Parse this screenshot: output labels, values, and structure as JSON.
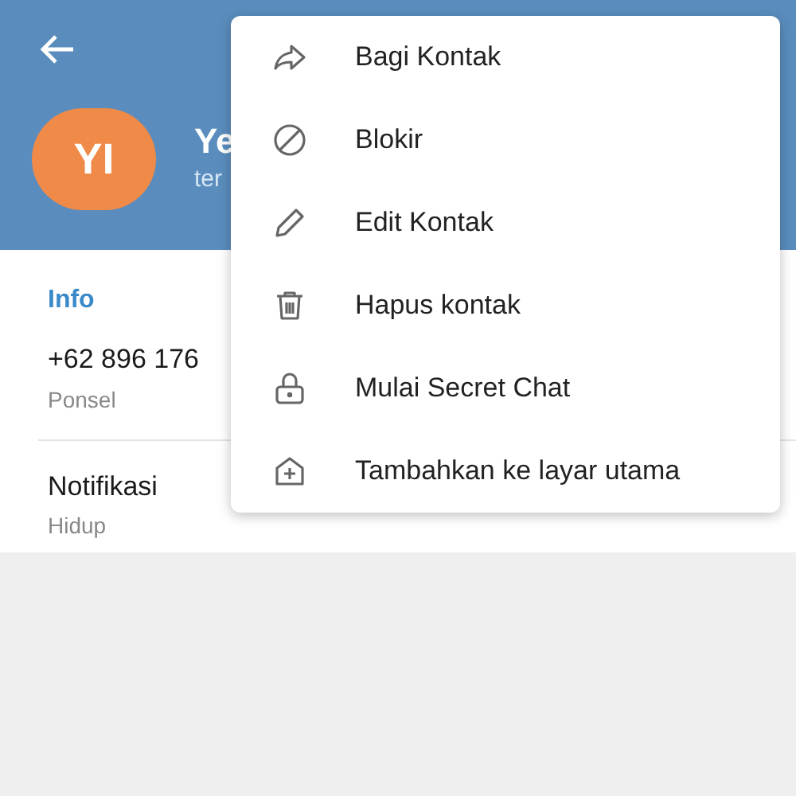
{
  "header": {
    "avatar_initials": "YI",
    "name": "Ye",
    "status": "ter"
  },
  "info": {
    "heading": "Info",
    "rows": [
      {
        "value": "+62 896 176",
        "label": "Ponsel"
      },
      {
        "value": "Notifikasi",
        "label": "Hidup"
      }
    ]
  },
  "menu": {
    "items": [
      "Bagi Kontak",
      "Blokir",
      "Edit Kontak",
      "Hapus kontak",
      "Mulai Secret Chat",
      "Tambahkan ke layar utama"
    ]
  }
}
